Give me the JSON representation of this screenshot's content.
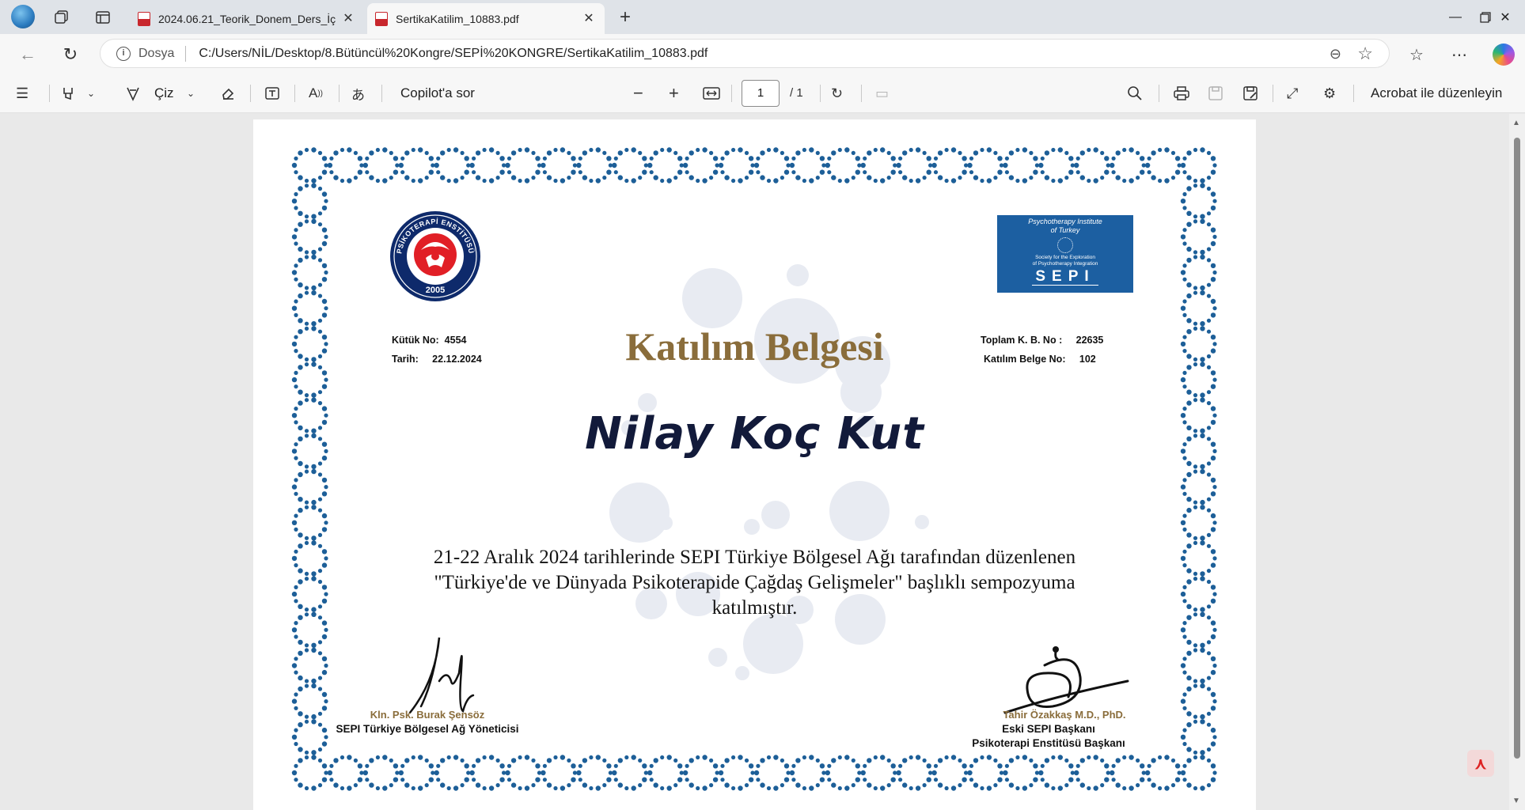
{
  "browser": {
    "tabs": [
      {
        "title": "2024.06.21_Teorik_Donem_Ders_İç",
        "active": false
      },
      {
        "title": "SertikaKatilim_10883.pdf",
        "active": true
      }
    ],
    "address": {
      "protocol_label": "Dosya",
      "url": "C:/Users/NİL/Desktop/8.Bütüncül%20Kongre/SEPİ%20KONGRE/SertikaKatilim_10883.pdf"
    }
  },
  "pdf_toolbar": {
    "draw_label": "Çiz",
    "copilot_label": "Copilot'a sor",
    "current_page": "1",
    "total_pages": "/ 1",
    "acrobat_label": "Acrobat ile düzenleyin"
  },
  "certificate": {
    "logo_left": {
      "top_text": "PSİKOTERAPİ ENSTİTÜSÜ",
      "year": "2005"
    },
    "logo_right": {
      "line1": "Psychotherapy Institute",
      "line2": "of Turkey",
      "line3": "Society for the Exploration",
      "line4": "of Psychotherapy Integration",
      "acronym": "SEPI"
    },
    "kutuk_label": "Kütük No:",
    "kutuk_value": "4554",
    "tarih_label": "Tarih:",
    "tarih_value": "22.12.2024",
    "toplam_label": "Toplam K. B. No :",
    "toplam_value": "22635",
    "katilim_no_label": "Katılım Belge No:",
    "katilim_no_value": "102",
    "title": "Katılım Belgesi",
    "recipient": "Nilay Koç Kut",
    "body_line1": "21-22 Aralık 2024 tarihlerinde SEPI Türkiye Bölgesel Ağı tarafından düzenlenen",
    "body_line2": "\"Türkiye'de ve Dünyada Psikoterapide Çağdaş Gelişmeler\" başlıklı sempozyuma",
    "body_line3": "katılmıştır.",
    "signer_left_name": "Kln. Psk. Burak Şensöz",
    "signer_left_role": "SEPI Türkiye Bölgesel Ağ Yöneticisi",
    "signer_right_name": "Tahir Özakkaş M.D., PhD.",
    "signer_right_role1": "Eski SEPI Başkanı",
    "signer_right_role2": "Psikoterapi Enstitüsü Başkanı"
  },
  "colors": {
    "border_dot": "#1d5f98",
    "title_gold": "#8a6d3b",
    "name_navy": "#121a3a",
    "sepi_blue": "#1c5fa1",
    "logo_red": "#e11f26"
  }
}
